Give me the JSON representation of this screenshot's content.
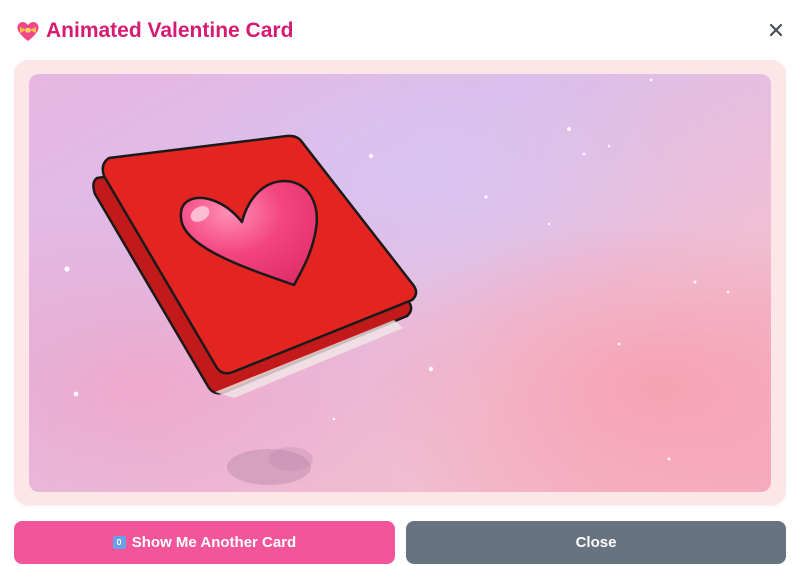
{
  "dialog": {
    "title": "Animated Valentine Card",
    "title_icon": "heart-with-ribbon-icon",
    "close_icon": "close-icon"
  },
  "stage": {
    "content": "valentine-card-illustration",
    "card_color": "#e42421",
    "heart_color": "#f25086"
  },
  "actions": {
    "another_label": "Show Me Another Card",
    "another_icon": "shuffle-icon",
    "close_label": "Close"
  },
  "colors": {
    "title": "#d81b72",
    "primary_button": "#f25599",
    "secondary_button": "#687382",
    "frame": "#fde6e8"
  }
}
